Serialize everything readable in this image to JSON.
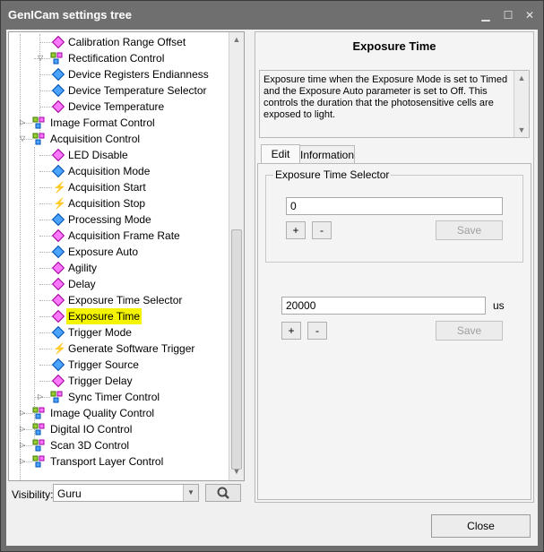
{
  "window": {
    "title": "GenICam settings tree",
    "minimize_glyph": "▁",
    "maximize_glyph": "☐",
    "close_glyph": "✕"
  },
  "tree": {
    "items": [
      {
        "label": "Calibration Range Offset",
        "icon": "pink-diamond-icon",
        "level": 2
      },
      {
        "label": "Rectification Control",
        "icon": "category-icon",
        "level": 1,
        "expanded": true
      },
      {
        "label": "Device Registers Endianness",
        "icon": "blue-diamond-icon",
        "level": 2
      },
      {
        "label": "Device Temperature Selector",
        "icon": "blue-diamond-icon",
        "level": 2
      },
      {
        "label": "Device Temperature",
        "icon": "pink-diamond-icon",
        "level": 2
      },
      {
        "label": "Image Format Control",
        "icon": "category-icon",
        "level": 0,
        "expanded": false
      },
      {
        "label": "Acquisition Control",
        "icon": "category-icon",
        "level": 0,
        "expanded": true
      },
      {
        "label": "LED Disable",
        "icon": "pink-diamond-icon",
        "level": 2
      },
      {
        "label": "Acquisition Mode",
        "icon": "blue-diamond-icon",
        "level": 2
      },
      {
        "label": "Acquisition Start",
        "icon": "command-bolt-icon",
        "level": 2
      },
      {
        "label": "Acquisition Stop",
        "icon": "command-bolt-icon",
        "level": 2
      },
      {
        "label": "Processing Mode",
        "icon": "blue-diamond-icon",
        "level": 2
      },
      {
        "label": "Acquisition Frame Rate",
        "icon": "pink-diamond-icon",
        "level": 2
      },
      {
        "label": "Exposure Auto",
        "icon": "blue-diamond-icon",
        "level": 2
      },
      {
        "label": "Agility",
        "icon": "pink-diamond-icon",
        "level": 2
      },
      {
        "label": "Delay",
        "icon": "pink-diamond-icon",
        "level": 2
      },
      {
        "label": "Exposure Time Selector",
        "icon": "pink-diamond-icon",
        "level": 2
      },
      {
        "label": "Exposure Time",
        "icon": "pink-diamond-icon",
        "level": 2,
        "selected": true
      },
      {
        "label": "Trigger Mode",
        "icon": "blue-diamond-icon",
        "level": 2
      },
      {
        "label": "Generate Software Trigger",
        "icon": "command-bolt-icon",
        "level": 2
      },
      {
        "label": "Trigger Source",
        "icon": "blue-diamond-icon",
        "level": 2
      },
      {
        "label": "Trigger Delay",
        "icon": "pink-diamond-icon",
        "level": 2
      },
      {
        "label": "Sync Timer Control",
        "icon": "category-icon",
        "level": 1,
        "expanded": false
      },
      {
        "label": "Image Quality Control",
        "icon": "category-icon",
        "level": 0,
        "expanded": false
      },
      {
        "label": "Digital IO Control",
        "icon": "category-icon",
        "level": 0,
        "expanded": false
      },
      {
        "label": "Scan 3D Control",
        "icon": "category-icon",
        "level": 0,
        "expanded": false
      },
      {
        "label": "Transport Layer Control",
        "icon": "category-icon",
        "level": 0,
        "expanded": false
      }
    ]
  },
  "visibility": {
    "label": "Visibility:",
    "value": "Guru"
  },
  "detail": {
    "title": "Exposure Time",
    "description": "Exposure time when the Exposure Mode is set to Timed and the Exposure Auto parameter is set to Off. This controls the duration that the photosensitive cells are exposed to light.",
    "tabs": [
      {
        "label": "Edit",
        "active": true
      },
      {
        "label": "Information",
        "active": false
      }
    ],
    "selector": {
      "title": "Exposure Time Selector",
      "value": "0",
      "plus": "+",
      "minus": "-",
      "save": "Save"
    },
    "value": {
      "value": "20000",
      "unit": "us",
      "plus": "+",
      "minus": "-",
      "save": "Save"
    }
  },
  "footer": {
    "close_label": "Close"
  },
  "colors": {
    "selected_highlight": "#f4f400",
    "title_bar": "#6f6f6f"
  }
}
